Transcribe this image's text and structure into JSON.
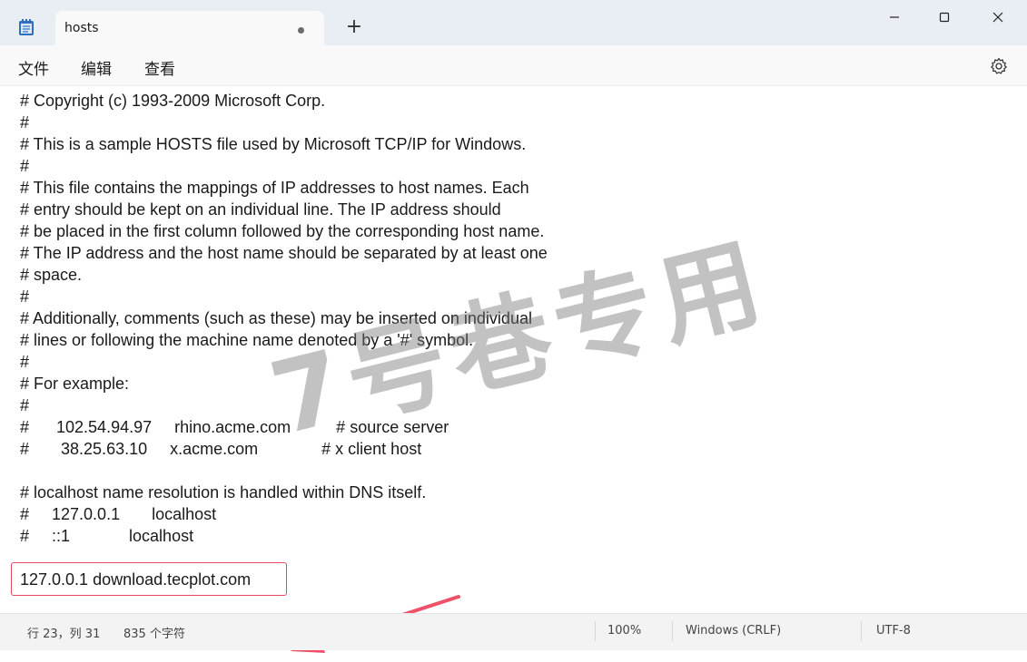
{
  "tab": {
    "title": "hosts"
  },
  "menu": {
    "file": "文件",
    "edit": "编辑",
    "view": "查看"
  },
  "editor": {
    "lines": [
      "# Copyright (c) 1993-2009 Microsoft Corp.",
      "#",
      "# This is a sample HOSTS file used by Microsoft TCP/IP for Windows.",
      "#",
      "# This file contains the mappings of IP addresses to host names. Each",
      "# entry should be kept on an individual line. The IP address should",
      "# be placed in the first column followed by the corresponding host name.",
      "# The IP address and the host name should be separated by at least one",
      "# space.",
      "#",
      "# Additionally, comments (such as these) may be inserted on individual",
      "# lines or following the machine name denoted by a '#' symbol.",
      "#",
      "# For example:",
      "#",
      "#      102.54.94.97     rhino.acme.com          # source server",
      "#       38.25.63.10     x.acme.com              # x client host",
      "",
      "# localhost name resolution is handled within DNS itself.",
      "#     127.0.0.1       localhost",
      "#     ::1             localhost",
      "",
      "127.0.0.1 download.tecplot.com"
    ]
  },
  "watermark": "7号巷专用",
  "status": {
    "position": "行 23，列 31",
    "char_count": "835 个字符",
    "zoom": "100%",
    "line_ending": "Windows (CRLF)",
    "encoding": "UTF-8"
  },
  "colors": {
    "highlight": "#e24a5f",
    "titlebar": "#e9eef4"
  },
  "icons": [
    "notepad-icon",
    "new-tab-plus-icon",
    "minimize-icon",
    "maximize-icon",
    "close-icon",
    "settings-gear-icon",
    "red-arrow-annotation"
  ]
}
